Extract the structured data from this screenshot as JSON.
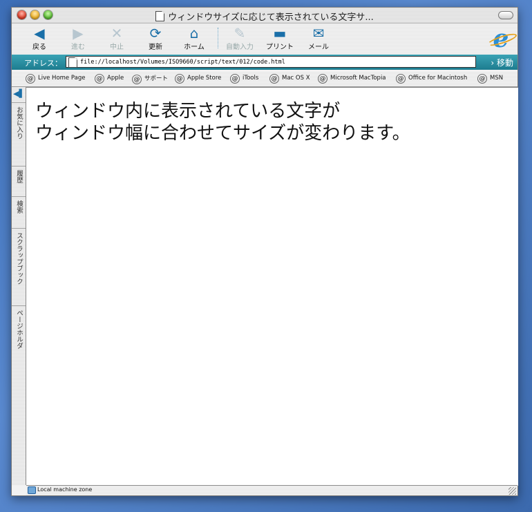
{
  "window": {
    "title": "ウィンドウサイズに応じて表示されている文字サ..."
  },
  "toolbar": {
    "buttons": [
      {
        "label": "戻る",
        "icon": "back-arrow-icon",
        "enabled": true
      },
      {
        "label": "進む",
        "icon": "forward-arrow-icon",
        "enabled": false
      },
      {
        "label": "中止",
        "icon": "stop-x-icon",
        "enabled": false
      },
      {
        "label": "更新",
        "icon": "refresh-icon",
        "enabled": true
      },
      {
        "label": "ホーム",
        "icon": "home-icon",
        "enabled": true
      },
      {
        "label": "自動入力",
        "icon": "autofill-icon",
        "enabled": false
      },
      {
        "label": "プリント",
        "icon": "printer-icon",
        "enabled": true
      },
      {
        "label": "メール",
        "icon": "mail-icon",
        "enabled": true
      }
    ],
    "logo": "e"
  },
  "address": {
    "label": "アドレス：",
    "url": "file://localhost/Volumes/ISO9660/script/text/012/code.html",
    "go_label": "移動"
  },
  "favorites": [
    "Live Home Page",
    "Apple",
    "サポート",
    "Apple Store",
    "iTools",
    "Mac OS X",
    "Microsoft MacTopia",
    "Office for Macintosh",
    "MSN"
  ],
  "sidebar": {
    "tabs": [
      "お気に入り",
      "履歴",
      "検索",
      "スクラップブック",
      "ページホルダ"
    ]
  },
  "content": {
    "line1": "ウィンドウ内に表示されている文字が",
    "line2": "ウィンドウ幅に合わせてサイズが変わります。"
  },
  "status": {
    "zone": "Local machine zone"
  },
  "colors": {
    "accent": "#1a6fa8",
    "address_bar": "#2a90a3"
  }
}
